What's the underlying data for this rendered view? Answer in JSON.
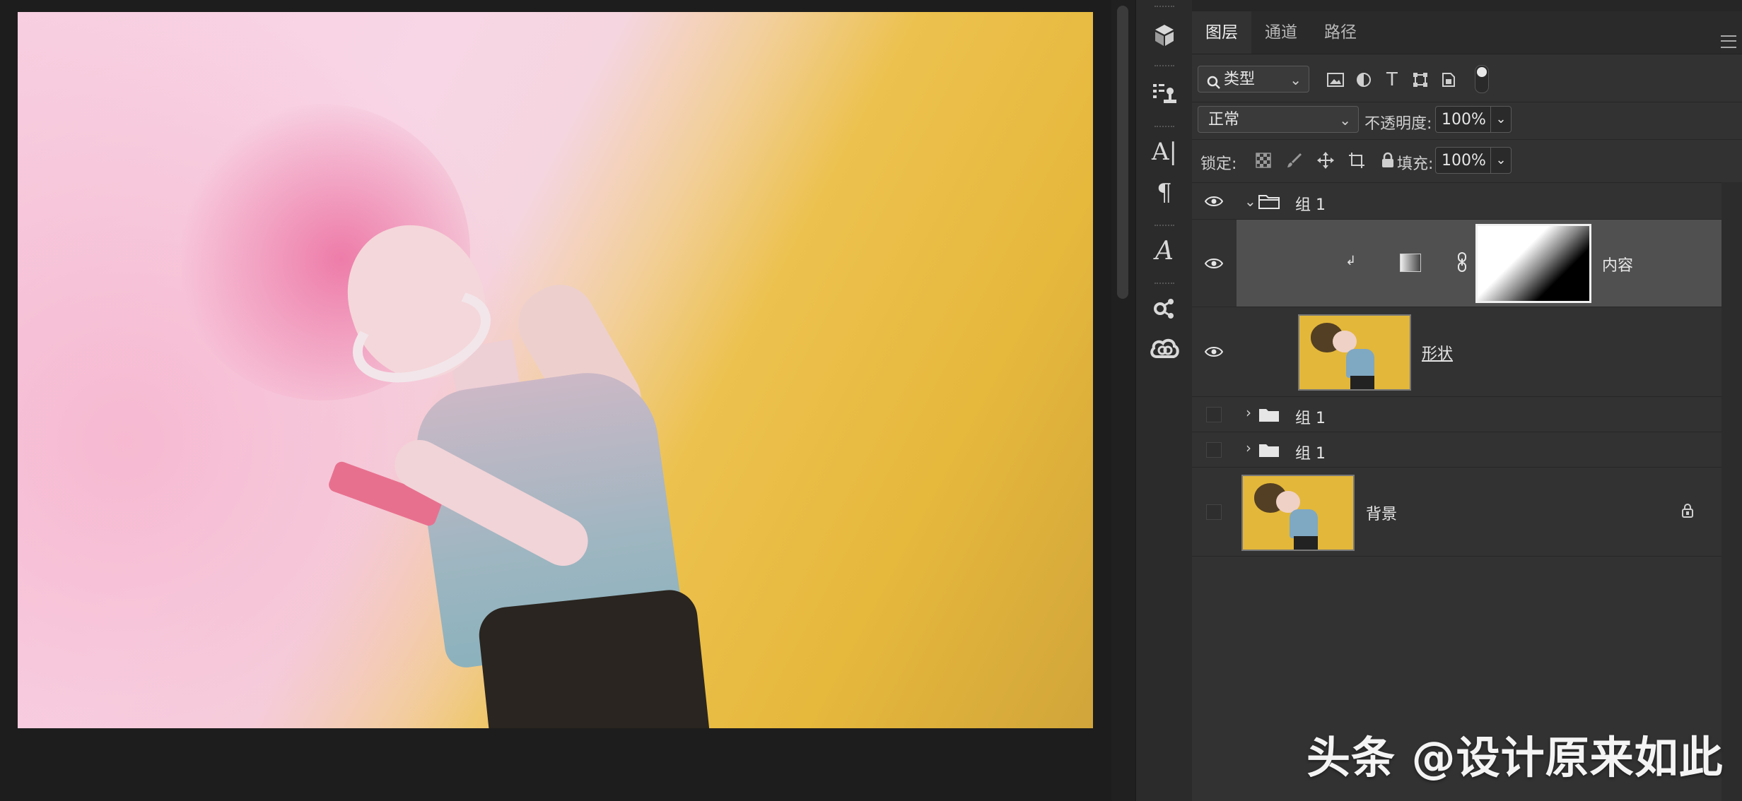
{
  "tabs": [
    {
      "label": "图层",
      "active": true
    },
    {
      "label": "通道",
      "active": false
    },
    {
      "label": "路径",
      "active": false
    }
  ],
  "filter": {
    "kind_label": "类型"
  },
  "blend": {
    "mode": "正常",
    "opacity_label": "不透明度:",
    "opacity_value": "100%"
  },
  "lock": {
    "label": "锁定:",
    "fill_label": "填充:",
    "fill_value": "100%"
  },
  "layers": [
    {
      "name": "组 1",
      "type": "group",
      "expanded": true,
      "visible": true
    },
    {
      "name": "内容",
      "type": "gradient-fill",
      "visible": true,
      "selected": true,
      "clipped": true
    },
    {
      "name": "形状",
      "type": "pixel",
      "visible": true
    },
    {
      "name": "组 1",
      "type": "group",
      "expanded": false,
      "visible": false
    },
    {
      "name": "组 1",
      "type": "group",
      "expanded": false,
      "visible": false
    },
    {
      "name": "背景",
      "type": "background",
      "visible": false,
      "locked": true
    }
  ],
  "watermark": "头条 @设计原来如此",
  "colors": {
    "accent_bg": "#323232",
    "selected_row": "#505050",
    "canvas_yellow": "#e6b83c",
    "canvas_pink": "#f7cfe0"
  }
}
